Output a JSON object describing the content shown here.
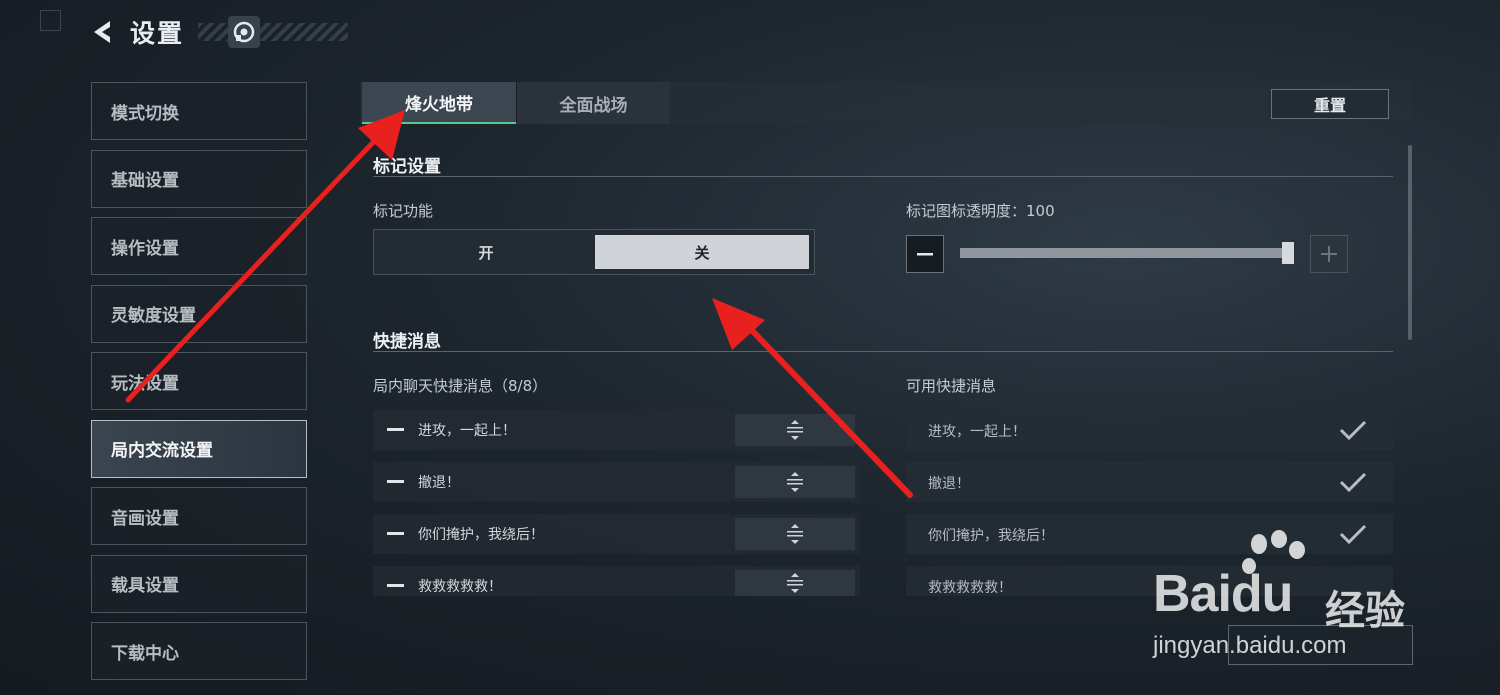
{
  "header": {
    "title": "设置"
  },
  "sidebar": {
    "items": [
      {
        "label": "模式切换"
      },
      {
        "label": "基础设置"
      },
      {
        "label": "操作设置"
      },
      {
        "label": "灵敏度设置"
      },
      {
        "label": "玩法设置"
      },
      {
        "label": "局内交流设置"
      },
      {
        "label": "音画设置"
      },
      {
        "label": "载具设置"
      },
      {
        "label": "下载中心"
      }
    ],
    "active_index": 5
  },
  "tabs": [
    {
      "label": "烽火地带"
    },
    {
      "label": "全面战场"
    }
  ],
  "reset_label": "重置",
  "mark_section": {
    "title": "标记设置",
    "function_label": "标记功能",
    "toggle_on": "开",
    "toggle_off": "关",
    "selected": "关",
    "opacity_label": "标记图标透明度：100",
    "opacity_value": 100
  },
  "quick_section": {
    "title": "快捷消息",
    "ingame_label": "局内聊天快捷消息（8/8）",
    "available_label": "可用快捷消息",
    "ingame_messages": [
      "进攻，一起上！",
      "撤退！",
      "你们掩护，我绕后！",
      "救救救救救！"
    ],
    "available_messages": [
      "进攻，一起上！",
      "撤退！",
      "你们掩护，我绕后！",
      "救救救救救！"
    ]
  },
  "watermark": {
    "brand": "Bai",
    "brand2": "du",
    "product": "经验",
    "url": "jingyan.baidu.com"
  },
  "colors": {
    "accent": "#58c890",
    "annotation": "#e8211f"
  }
}
